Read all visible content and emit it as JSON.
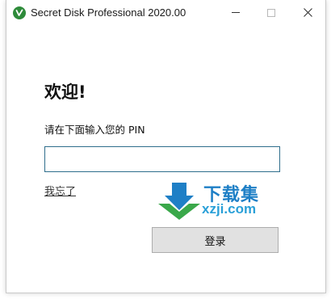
{
  "window": {
    "title": "Secret Disk Professional 2020.00",
    "app_icon": "secret-disk-app-icon",
    "controls": {
      "minimize_icon": "minimize-icon",
      "maximize_icon": "maximize-icon",
      "close_icon": "close-icon"
    }
  },
  "login": {
    "welcome": "欢迎!",
    "prompt": "请在下面输入您的 PIN",
    "pin_value": "",
    "forgot_link": "我忘了",
    "login_button": "登录"
  },
  "watermark": {
    "line1": "下载集",
    "line2": "xzji.com",
    "colors": {
      "blue": "#1e7fc6",
      "green": "#3aa84a"
    }
  },
  "colors": {
    "accent": "#2f6e8c",
    "app_icon_green": "#2e8b3a",
    "button_bg": "#e1e1e1"
  }
}
